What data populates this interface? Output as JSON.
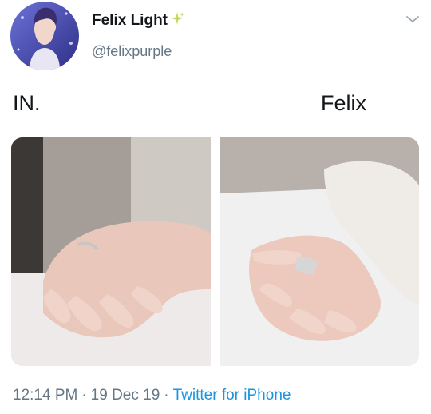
{
  "tweet": {
    "display_name": "Felix Light",
    "handle": "@felixpurple",
    "badge_icon": "sparkles-icon",
    "menu_icon": "chevron-down-icon",
    "body": {
      "left_label": "IN.",
      "right_label": "Felix"
    },
    "footer": {
      "time": "12:14 PM",
      "separator": "·",
      "date": "19 Dec 19",
      "source": "Twitter for iPhone"
    }
  },
  "colors": {
    "text": "#14171a",
    "secondary": "#657786",
    "link": "#1b95e0",
    "badge": "#c9d65a"
  }
}
